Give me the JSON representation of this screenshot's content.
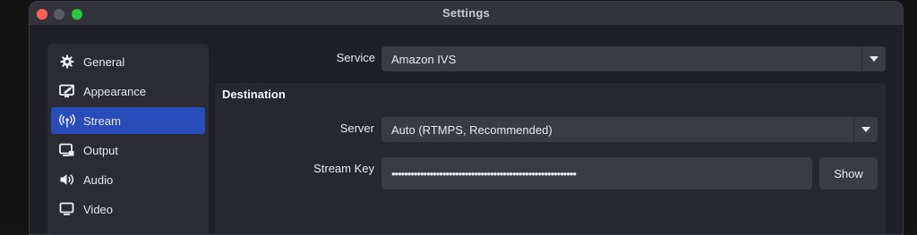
{
  "window": {
    "title": "Settings"
  },
  "sidebar": {
    "items": [
      {
        "label": "General",
        "icon": "gear-icon",
        "active": false
      },
      {
        "label": "Appearance",
        "icon": "appearance-icon",
        "active": false
      },
      {
        "label": "Stream",
        "icon": "broadcast-icon",
        "active": true
      },
      {
        "label": "Output",
        "icon": "output-icon",
        "active": false
      },
      {
        "label": "Audio",
        "icon": "speaker-icon",
        "active": false
      },
      {
        "label": "Video",
        "icon": "monitor-icon",
        "active": false
      }
    ]
  },
  "stream": {
    "service_label": "Service",
    "service_value": "Amazon IVS",
    "destination": {
      "title": "Destination",
      "server_label": "Server",
      "server_value": "Auto (RTMPS, Recommended)",
      "stream_key_label": "Stream Key",
      "stream_key_value": "••••••••••••••••••••••••••••••••••••••••••••••••••••••••••",
      "show_button": "Show"
    }
  },
  "colors": {
    "accent": "#284cb8",
    "window_bg": "#1f2026",
    "field_bg": "#3a3b44",
    "close": "#fe5f57",
    "maximize": "#2ac840"
  }
}
